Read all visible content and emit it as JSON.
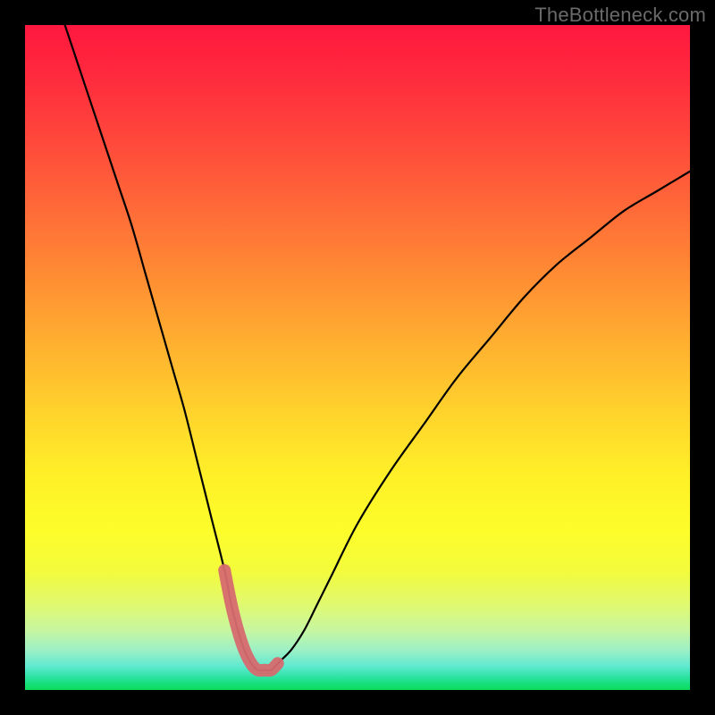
{
  "watermark": "TheBottleneck.com",
  "chart_data": {
    "type": "line",
    "title": "",
    "xlabel": "",
    "ylabel": "",
    "xlim": [
      0,
      100
    ],
    "ylim": [
      0,
      100
    ],
    "grid": false,
    "legend": false,
    "series": [
      {
        "name": "bottleneck-curve",
        "x": [
          6,
          8,
          10,
          12,
          14,
          16,
          18,
          20,
          22,
          24,
          26,
          28,
          30,
          31,
          32,
          33,
          34,
          35,
          36,
          37,
          38,
          40,
          42,
          44,
          46,
          50,
          55,
          60,
          65,
          70,
          75,
          80,
          85,
          90,
          95,
          100
        ],
        "y": [
          100,
          94,
          88,
          82,
          76,
          70,
          63,
          56,
          49,
          42,
          34,
          26,
          18,
          13,
          9,
          6,
          4,
          3,
          3,
          3,
          4,
          6,
          9,
          13,
          17,
          25,
          33,
          40,
          47,
          53,
          59,
          64,
          68,
          72,
          75,
          78
        ]
      }
    ],
    "marker_region": {
      "description": "pink blob marker around curve minimum",
      "x_range": [
        30,
        39
      ],
      "y_range": [
        2,
        10
      ]
    },
    "gradient_colors": {
      "top": "#ff173f",
      "mid": "#ffe028",
      "bottom": "#0bdc5a"
    }
  }
}
